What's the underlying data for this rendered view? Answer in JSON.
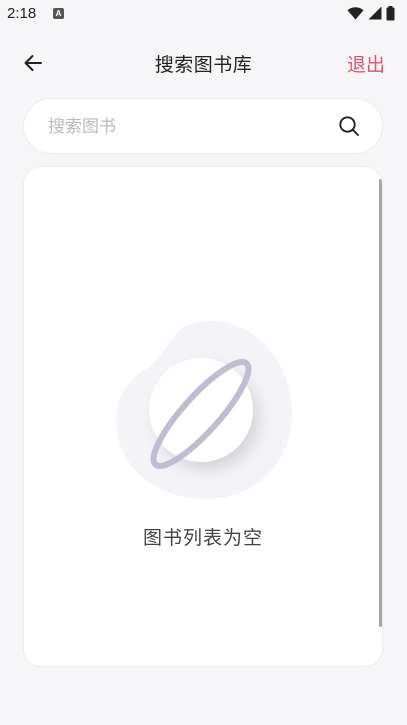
{
  "status_bar": {
    "time": "2:18",
    "notification_icon": "a-icon",
    "icons": [
      "wifi-icon",
      "signal-icon",
      "battery-icon"
    ]
  },
  "header": {
    "back_icon": "arrow-left-icon",
    "title": "搜索图书库",
    "exit_label": "退出"
  },
  "search": {
    "placeholder": "搜索图书",
    "value": "",
    "icon": "search-icon"
  },
  "content": {
    "empty_text": "图书列表为空",
    "illustration": "planet-icon"
  },
  "colors": {
    "accent": "#e0566b",
    "background": "#f6f6f8",
    "card": "#ffffff",
    "placeholder": "#b9b9be",
    "planet_ring": "#bebdd2"
  }
}
